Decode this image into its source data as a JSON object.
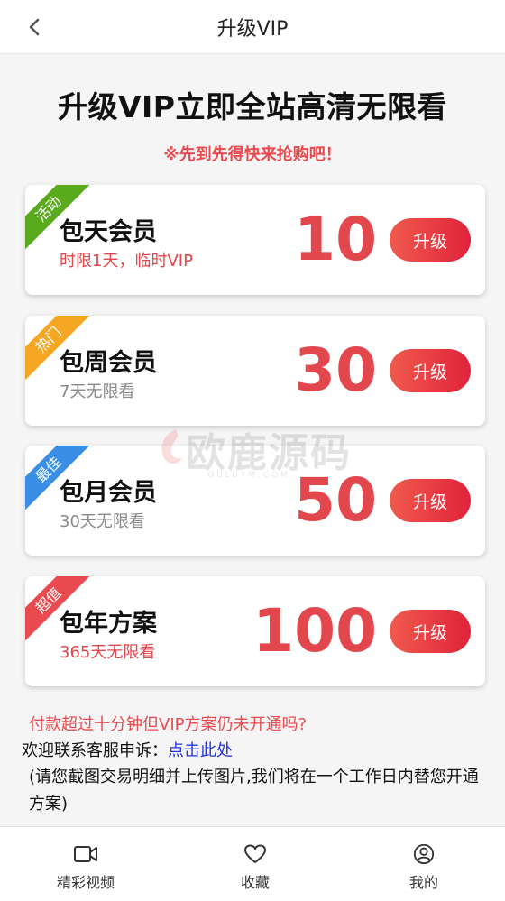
{
  "header": {
    "title": "升级VIP"
  },
  "hero": {
    "headline": "升级VIP立即全站高清无限看",
    "subline": "※先到先得快来抢购吧！"
  },
  "plans": [
    {
      "badge": "活动",
      "badge_color": "#5aaa1e",
      "name": "包天会员",
      "desc": "时限1天，临时VIP",
      "desc_color": "#e2474d",
      "price": "10",
      "button": "升级"
    },
    {
      "badge": "热门",
      "badge_color": "#f5a623",
      "name": "包周会员",
      "desc": "7天无限看",
      "desc_color": "#888888",
      "price": "30",
      "button": "升级"
    },
    {
      "badge": "最佳",
      "badge_color": "#3a8ee6",
      "name": "包月会员",
      "desc": "30天无限看",
      "desc_color": "#888888",
      "price": "50",
      "button": "升级"
    },
    {
      "badge": "超值",
      "badge_color": "#e84a4f",
      "name": "包年方案",
      "desc": "365天无限看",
      "desc_color": "#e2474d",
      "price": "100",
      "button": "升级"
    }
  ],
  "watermark": {
    "main": "欧鹿源码",
    "sub": "OULUYM.COM"
  },
  "notice": {
    "question": "付款超过十分钟但VIP方案仍未开通吗?",
    "contact_prefix": "欢迎联系客服申诉：",
    "contact_link": "点击此处",
    "note": "(请您截图交易明细并上传图片,我们将在一个工作日内替您开通方案)"
  },
  "tabbar": {
    "items": [
      {
        "label": "精彩视频",
        "icon": "video-camera-icon"
      },
      {
        "label": "收藏",
        "icon": "heart-icon"
      },
      {
        "label": "我的",
        "icon": "user-icon"
      }
    ]
  },
  "colors": {
    "accent": "#e2474d",
    "button_start": "#f05a4d",
    "button_end": "#e0233b",
    "link": "#2233dd"
  }
}
